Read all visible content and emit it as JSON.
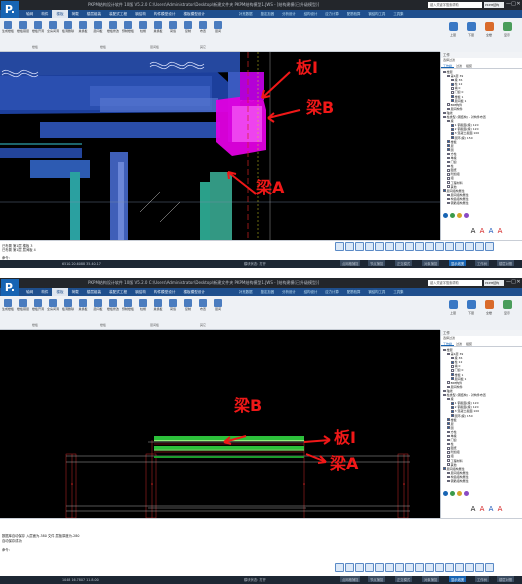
{
  "app": {
    "logo_text": "P.",
    "title": "PKPM结构设计软件 10版 V5.2.0 C:\\Users\\Administrator\\Desktop\\新建文件夹 PKPM结构模型1.JWS - [结构建模(已升级模型)]",
    "search_placeholder": "键入关键字搜索帮助",
    "combo_value": "PKPM结构",
    "window_controls": [
      "—",
      "□",
      "✕"
    ]
  },
  "menu": {
    "items": [
      "轴网",
      "构件",
      "楼板",
      "荷载",
      "楼层组装",
      "装配式工程",
      "钢结构",
      "构件模型设计",
      "楼板模型设计",
      "结构"
    ],
    "active_index": 2,
    "module_tabs": [
      "补充数据",
      "鉴定加固",
      "分析设计",
      "结构设计",
      "应力计算",
      "配筋验算",
      "钢结构工具",
      "工具集"
    ]
  },
  "ribbon": {
    "buttons": [
      "生成楼板",
      "楼板错层",
      "楼板开洞",
      "全房间洞",
      "板洞删除",
      "悬挑板",
      "层间板",
      "楼板修改",
      "预制楼板",
      "柱帽",
      "悬挑板",
      "荷载",
      "复制",
      "布置",
      "层间",
      "复制楼板",
      "楼板高级",
      "组合构件"
    ],
    "groups": [
      "楼板",
      "楼板",
      "层间板",
      "楼板组",
      "其它"
    ],
    "right_buttons": [
      "上层",
      "下层",
      "全楼",
      "显示"
    ]
  },
  "panel": {
    "title": "工作",
    "subtitle": "选择过滤",
    "tabs": [
      "工作树",
      "过滤",
      "组装"
    ],
    "tree": [
      {
        "text": "楼层",
        "indent": 0,
        "checked": true
      },
      {
        "text": "第1层 39",
        "indent": 1,
        "checked": true
      },
      {
        "text": "梁 36",
        "indent": 2,
        "checked": true
      },
      {
        "text": "柱 12",
        "indent": 2,
        "checked": true
      },
      {
        "text": "墙 0",
        "indent": 2,
        "checked": false
      },
      {
        "text": "门窗 0",
        "indent": 2,
        "checked": false
      },
      {
        "text": "楼板 1",
        "indent": 2,
        "checked": true
      },
      {
        "text": "层间板 1",
        "indent": 2,
        "checked": true
      },
      {
        "text": "BIM构件",
        "indent": 1,
        "checked": false
      },
      {
        "text": "层间构件",
        "indent": 1,
        "checked": false
      },
      {
        "text": "轴线",
        "indent": 0,
        "checked": true
      },
      {
        "text": "柱类型 (钢结构) - 对构件布置",
        "indent": 0,
        "checked": true
      },
      {
        "text": "梁",
        "indent": 1,
        "checked": true
      },
      {
        "text": "1 钢截面(梁) 120",
        "indent": 2,
        "checked": true
      },
      {
        "text": "2 钢截面(梁) 120",
        "indent": 2,
        "checked": true
      },
      {
        "text": "3 混凝土截面 100",
        "indent": 2,
        "checked": true
      },
      {
        "text": "圆环(梁) 150",
        "indent": 2,
        "checked": true
      },
      {
        "text": "楼板",
        "indent": 1,
        "checked": true
      },
      {
        "text": "层",
        "indent": 1,
        "checked": true
      },
      {
        "text": "圆",
        "indent": 1,
        "checked": true
      },
      {
        "text": "方柱",
        "indent": 1,
        "checked": true
      },
      {
        "text": "单梁",
        "indent": 1,
        "checked": true
      },
      {
        "text": "门窗",
        "indent": 1,
        "checked": false
      },
      {
        "text": "柱",
        "indent": 1,
        "checked": true
      },
      {
        "text": "图纸",
        "indent": 1,
        "checked": false
      },
      {
        "text": "附加组",
        "indent": 1,
        "checked": false
      },
      {
        "text": "组",
        "indent": 1,
        "checked": false
      },
      {
        "text": "工程材料",
        "indent": 1,
        "checked": false
      },
      {
        "text": "其他",
        "indent": 1,
        "checked": false
      },
      {
        "text": "层间组构属性",
        "indent": 0,
        "checked": true
      },
      {
        "text": "层间组构属性",
        "indent": 1,
        "checked": true
      },
      {
        "text": "构造组构属性",
        "indent": 1,
        "checked": false
      },
      {
        "text": "钢筋组构属性",
        "indent": 1,
        "checked": false
      }
    ],
    "font_buttons": [
      "A",
      "A",
      "A",
      "A"
    ]
  },
  "screens": [
    {
      "id": "top",
      "annotations": [
        "板I",
        "梁B",
        "梁A"
      ],
      "cmd_lines": [
        "已布置 第1层 楼板 3",
        "已布置 第1层 层间板 4",
        "",
        "命令:"
      ],
      "status_coords": "6510.20.6088 35.40.17",
      "status_mode": "模块状态: 打开",
      "status_buttons": [
        "点网格捕捉",
        "节点捕捉",
        "正交模式",
        "对象捕捉",
        "",
        "显示线宽",
        "工作树",
        "楼层对照"
      ]
    },
    {
      "id": "bottom",
      "annotations": [
        "梁B",
        "板I",
        "梁A"
      ],
      "cmd_lines": [
        "数据库自动保存 入层面为-380 文件 层板厚度为-280",
        "自动保存成功",
        "命令:"
      ],
      "status_coords": "1048 16.7807 11.8.00",
      "status_mode": "模块状态: 打开",
      "status_buttons": [
        "点网格捕捉",
        "节点捕捉",
        "正交模式",
        "对象捕捉",
        "",
        "显示线宽",
        "工作树",
        "楼层对照"
      ]
    }
  ],
  "colors": {
    "titlebar": "#23262b",
    "menubar": "#1f4f8d",
    "viewport": "#000000",
    "beam": "#1f4fa8",
    "slab_highlight": "#e000e0",
    "slab_green": "#2cc03a",
    "annotation": "#f01818"
  }
}
